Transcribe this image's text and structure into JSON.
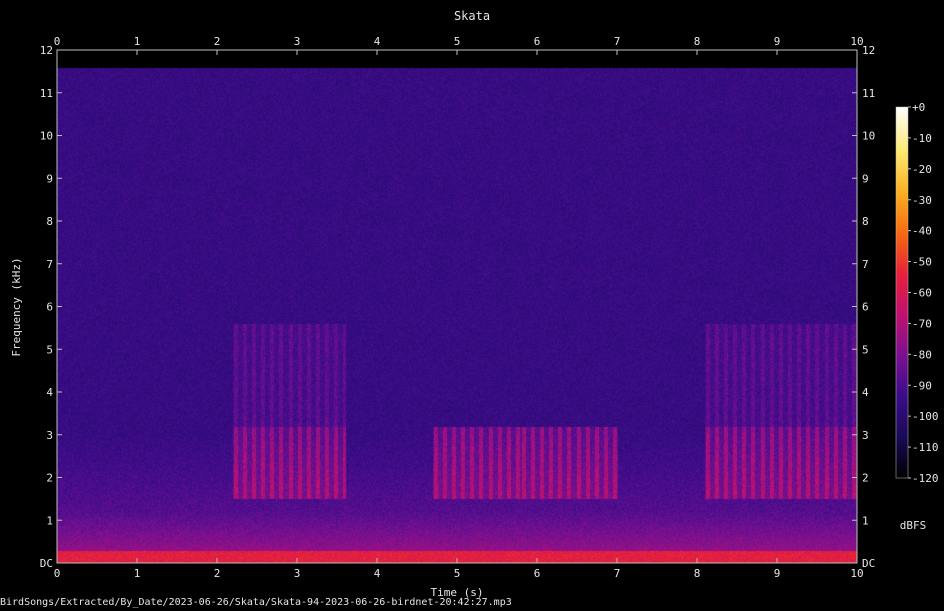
{
  "chart_data": {
    "type": "heatmap",
    "title": "Skata",
    "xlabel": "Time (s)",
    "ylabel": "Frequency (kHz)",
    "xlim": [
      0,
      10
    ],
    "ylim": [
      0,
      12
    ],
    "x_ticks": [
      "0",
      "1",
      "2",
      "3",
      "4",
      "5",
      "6",
      "7",
      "8",
      "9",
      "10"
    ],
    "y_ticks": [
      "DC",
      "1",
      "2",
      "3",
      "4",
      "5",
      "6",
      "7",
      "8",
      "9",
      "10",
      "11",
      "12"
    ],
    "colorbar": {
      "label": "dBFS",
      "ticks": [
        "+0",
        "-10",
        "-20",
        "-30",
        "-40",
        "-50",
        "-60",
        "-70",
        "-80",
        "-90",
        "-100",
        "-110",
        "-120"
      ],
      "range": [
        -120,
        0
      ],
      "colors": [
        "#000000",
        "#1a0a55",
        "#3a0c8a",
        "#7a1190",
        "#c01070",
        "#e8203a",
        "#f56a10",
        "#fbb020",
        "#fde870",
        "#ffffff"
      ]
    },
    "grid": false,
    "background_level_db": -95,
    "upper_cutoff_khz": 11.6,
    "call_segments_s": [
      {
        "start": 2.2,
        "end": 3.6,
        "band_khz": [
          1.5,
          5.6
        ]
      },
      {
        "start": 4.7,
        "end": 5.8,
        "band_khz": [
          1.5,
          3.2
        ]
      },
      {
        "start": 5.8,
        "end": 7.0,
        "band_khz": [
          1.5,
          3.2
        ]
      },
      {
        "start": 8.1,
        "end": 10.0,
        "band_khz": [
          1.5,
          5.6
        ]
      }
    ],
    "low_frequency_band_khz": [
      0,
      0.3
    ],
    "low_frequency_level_db": -55
  },
  "caption": "BirdSongs/Extracted/By_Date/2023-06-26/Skata/Skata-94-2023-06-26-birdnet-20:42:27.mp3"
}
